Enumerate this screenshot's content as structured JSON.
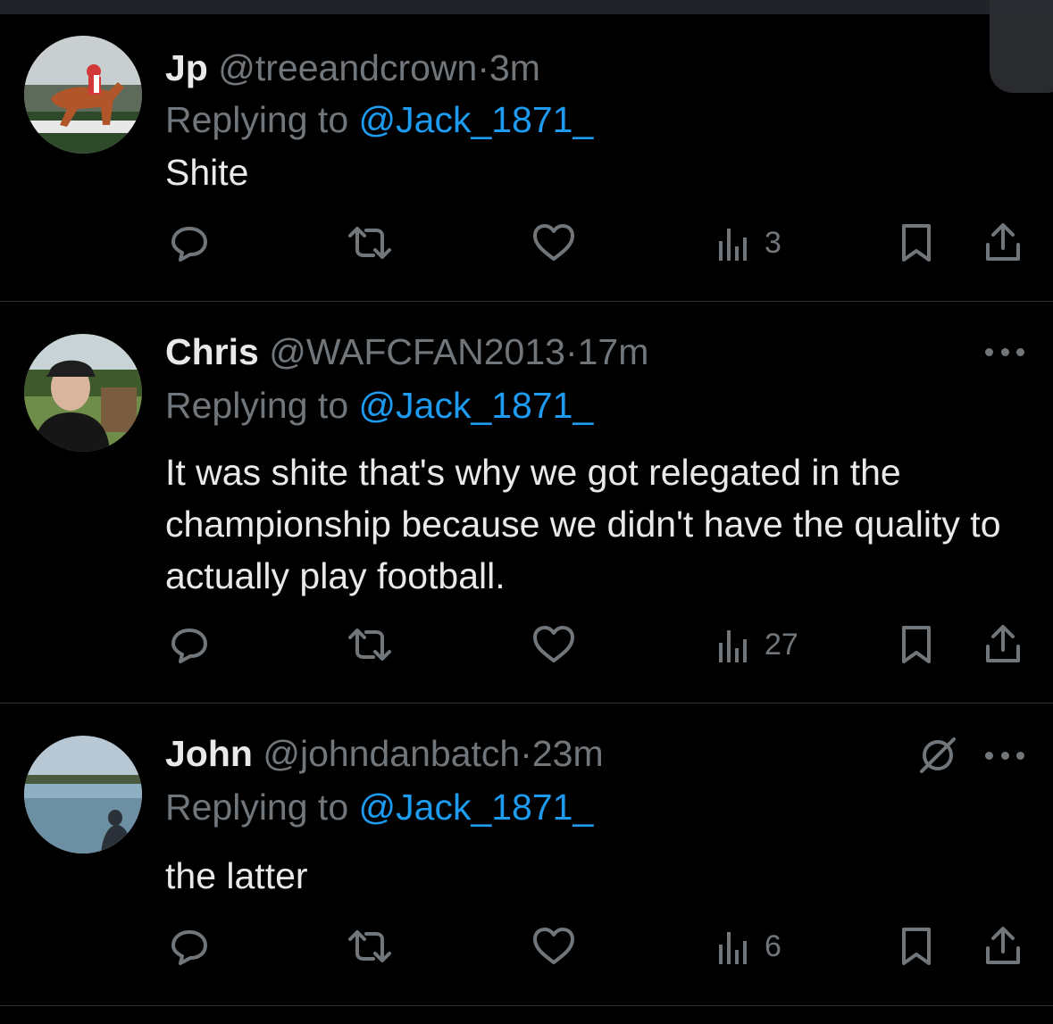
{
  "tweets": [
    {
      "name": "Jp",
      "handle": "@treeandcrown",
      "separator": "·",
      "time": "3m",
      "replying_prefix": "Replying to ",
      "replying_handle": "@Jack_1871_",
      "text": "Shite",
      "views": "3",
      "avatar_icon": "horse-racing-avatar"
    },
    {
      "name": "Chris",
      "handle": "@WAFCFAN2013",
      "separator": "·",
      "time": "17m",
      "replying_prefix": "Replying to ",
      "replying_handle": "@Jack_1871_",
      "text": "It was shite that's why we got relegated in the championship because we didn't have the quality to actually play football.",
      "views": "27",
      "avatar_icon": "man-with-cap-avatar"
    },
    {
      "name": "John",
      "handle": "@johndanbatch",
      "separator": "·",
      "time": "23m",
      "replying_prefix": "Replying to ",
      "replying_handle": "@Jack_1871_",
      "text": "the latter",
      "views": "6",
      "avatar_icon": "lake-avatar"
    }
  ],
  "colors": {
    "background": "#000000",
    "primary_text": "#e7e9ea",
    "secondary_text": "#71767b",
    "link": "#1d9bf0",
    "divider": "#2f3336"
  },
  "icons": [
    "reply-icon",
    "retweet-icon",
    "like-icon",
    "views-icon",
    "bookmark-icon",
    "share-icon",
    "more-icon",
    "grok-icon"
  ]
}
